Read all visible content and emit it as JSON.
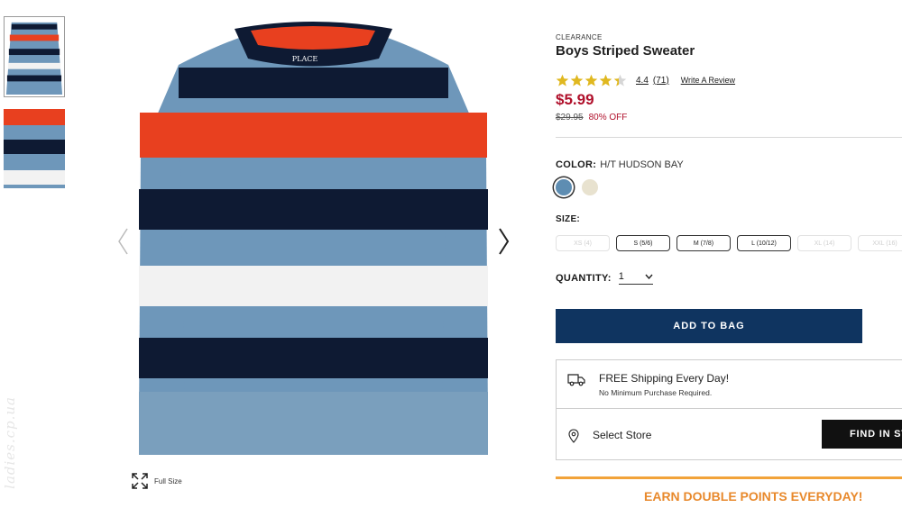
{
  "gallery": {
    "thumbnails": [
      "front-view",
      "detail-view"
    ],
    "full_size_label": "Full Size",
    "brand_tag": "PLACE"
  },
  "product": {
    "badge": "CLEARANCE",
    "title": "Boys Striped Sweater",
    "rating": {
      "stars": 4.4,
      "value": "4.4",
      "count": "(71)",
      "write_review": "Write A Review"
    },
    "price": "$5.99",
    "original_price": "$29.95",
    "discount": "80% OFF"
  },
  "color": {
    "label": "COLOR:",
    "selected": "H/T HUDSON BAY",
    "swatches": [
      {
        "name": "H/T HUDSON BAY",
        "hex": "#5e8db2",
        "selected": true
      },
      {
        "name": "cream",
        "hex": "#e8e2cf",
        "selected": false
      }
    ]
  },
  "size": {
    "label": "SIZE:",
    "options": [
      {
        "label": "XS (4)",
        "available": false
      },
      {
        "label": "S (5/6)",
        "available": true
      },
      {
        "label": "M (7/8)",
        "available": true
      },
      {
        "label": "L (10/12)",
        "available": true
      },
      {
        "label": "XL (14)",
        "available": false
      },
      {
        "label": "XXL (16)",
        "available": false
      }
    ]
  },
  "quantity": {
    "label": "QUANTITY:",
    "value": "1"
  },
  "add_to_bag": "ADD TO BAG",
  "shipping": {
    "title": "FREE Shipping Every Day!",
    "subtitle": "No Minimum Purchase Required.",
    "store_label": "Select Store",
    "find_label": "FIND IN STORE"
  },
  "promo": "EARN DOUBLE POINTS EVERYDAY!",
  "watermark": "ladies.cp.ua",
  "colors": {
    "price_red": "#b0102b",
    "navy_button": "#0f3460",
    "promo_orange": "#e8892c",
    "sweater_blue": "#6e97ba",
    "stripe_navy": "#0e1a33",
    "stripe_red": "#e8401f"
  }
}
